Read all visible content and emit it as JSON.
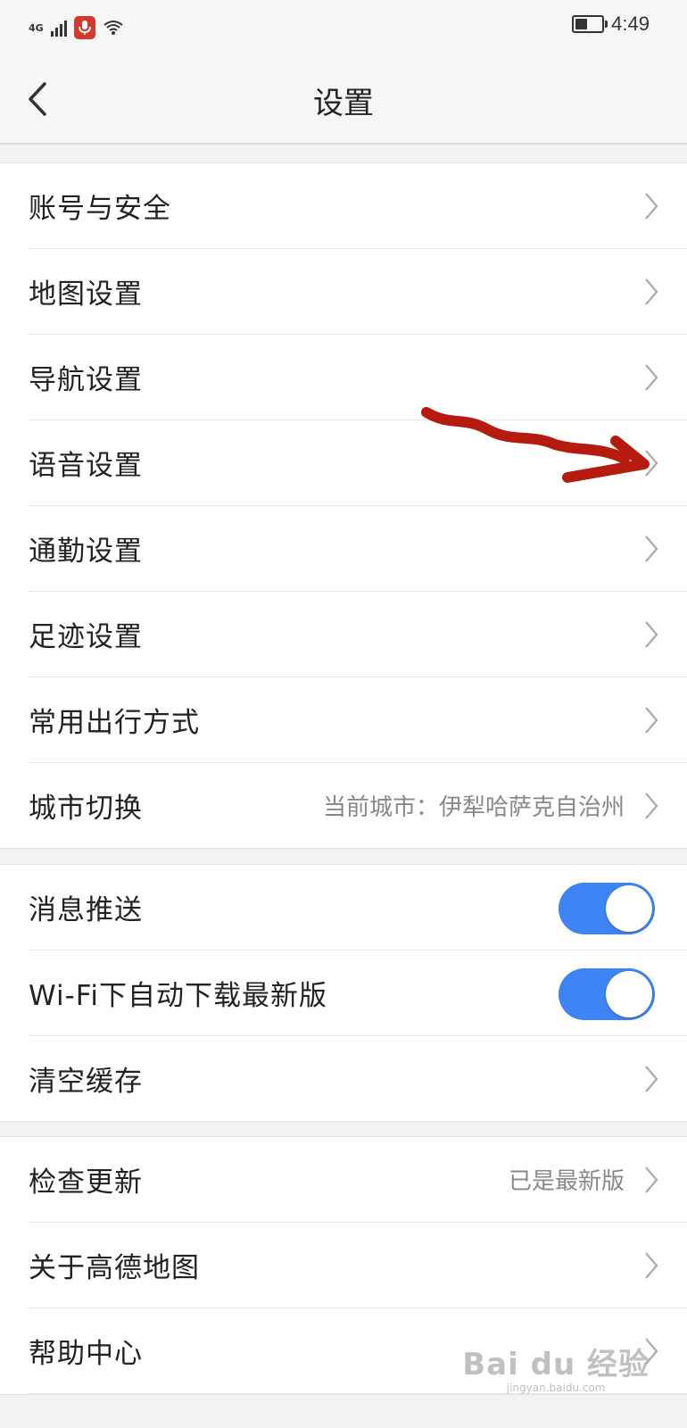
{
  "status_bar": {
    "network": "4G",
    "time": "4:49",
    "battery_level": 0.45,
    "icons": [
      "signal-icon",
      "mic-icon",
      "wifi-icon",
      "battery-icon"
    ]
  },
  "header": {
    "title": "设置",
    "back_icon": "chevron-left-icon"
  },
  "group1": {
    "items": [
      {
        "label": "账号与安全"
      },
      {
        "label": "地图设置"
      },
      {
        "label": "导航设置"
      },
      {
        "label": "语音设置"
      },
      {
        "label": "通勤设置"
      },
      {
        "label": "足迹设置"
      },
      {
        "label": "常用出行方式"
      },
      {
        "label": "城市切换",
        "value": "当前城市：伊犁哈萨克自治州"
      }
    ]
  },
  "group2": {
    "items": [
      {
        "label": "消息推送",
        "toggle_on": true
      },
      {
        "label": "Wi-Fi下自动下载最新版",
        "toggle_on": true
      },
      {
        "label": "清空缓存"
      }
    ]
  },
  "group3": {
    "items": [
      {
        "label": "检查更新",
        "value": "已是最新版"
      },
      {
        "label": "关于高德地图"
      },
      {
        "label": "帮助中心"
      }
    ]
  },
  "colors": {
    "toggle_on": "#3f84f4",
    "annotation_arrow": "#b51c0f",
    "mic_badge": "#d33a2f"
  },
  "watermark": {
    "main": "Bai du 经验",
    "sub": "jingyan.baidu.com"
  }
}
